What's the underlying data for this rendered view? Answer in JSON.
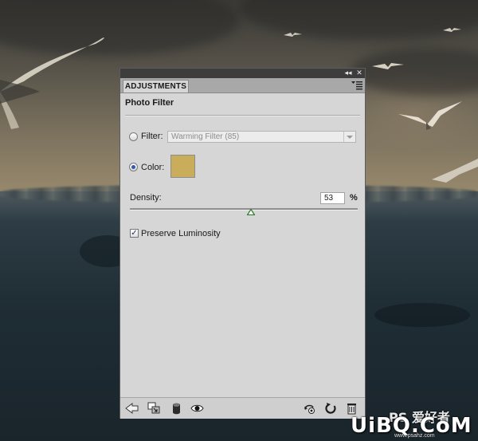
{
  "panel": {
    "tab_label": "ADJUSTMENTS",
    "title": "Photo Filter",
    "filter_label": "Filter:",
    "filter_value": "Warming Filter (85)",
    "color_label": "Color:",
    "selected_option": "Color",
    "color_hex": "#c9ad5b",
    "density_label": "Density:",
    "density_value": "53",
    "density_unit": "%",
    "density_level": 53,
    "preserve_label": "Preserve Luminosity",
    "preserve_checked": true,
    "top_buttons": [
      "collapse-icon",
      "close-icon"
    ],
    "bottom_icons": [
      "back-arrow-icon",
      "clip-layer-icon",
      "visibility-mask-icon",
      "eye-icon",
      "previous-state-icon",
      "reset-icon",
      "trash-icon"
    ]
  },
  "watermark": {
    "text": "UiBQ.CoM",
    "top_text": "PS 爱好者",
    "url": "www.psahz.com"
  },
  "colors": {
    "panel_bg": "#d6d6d6",
    "accent_radio": "#3558a8",
    "slider_thumb": "#2f7a2f"
  }
}
